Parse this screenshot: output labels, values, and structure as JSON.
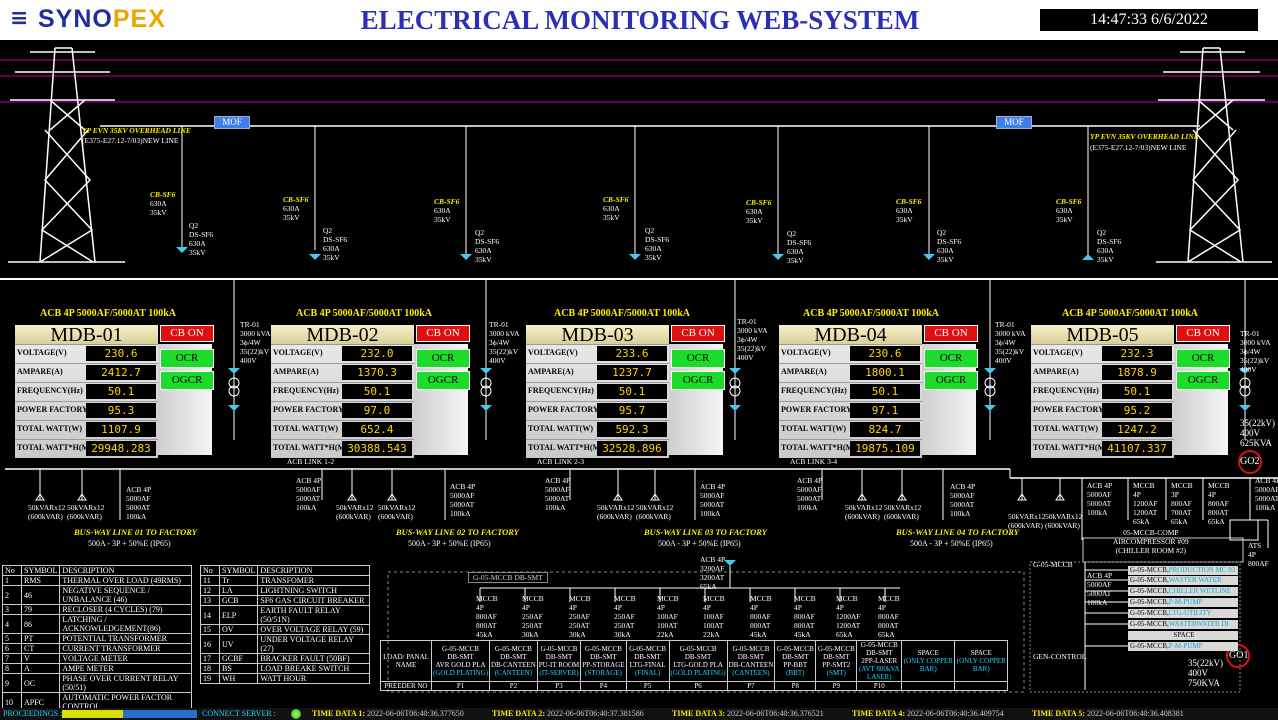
{
  "header": {
    "logo_part1": "SYNO",
    "logo_part2": "PEX",
    "title": "ELECTRICAL MONITORING WEB-SYSTEM",
    "clock": "14:47:33 6/6/2022"
  },
  "row_labels": [
    "VOLTAGE(V)",
    "AMPARE(A)",
    "FREQUENCY(Hz)",
    "POWER FACTORY(%)",
    "TOTAL WATT(W)",
    "TOTAL WATT*H(MWh)"
  ],
  "acb_title": "ACB 4P 5000AF/5000AT 100kA",
  "cb_on": "CB ON",
  "ocr": "OCR",
  "ogcr": "OGCR",
  "panels": [
    {
      "name": "MDB-01",
      "values": [
        "230.6",
        "2412.7",
        "50.1",
        "95.3",
        "1107.9",
        "29948.283"
      ]
    },
    {
      "name": "MDB-02",
      "values": [
        "232.0",
        "1370.3",
        "50.1",
        "97.0",
        "652.4",
        "30388.543"
      ]
    },
    {
      "name": "MDB-03",
      "values": [
        "233.6",
        "1237.7",
        "50.1",
        "95.7",
        "592.3",
        "32528.896"
      ]
    },
    {
      "name": "MDB-04",
      "values": [
        "230.6",
        "1800.1",
        "50.1",
        "97.1",
        "824.7",
        "19875.109"
      ]
    },
    {
      "name": "MDB-05",
      "values": [
        "232.3",
        "1878.9",
        "50.1",
        "95.2",
        "1247.2",
        "41107.337"
      ]
    }
  ],
  "overhead_line": "YP EVN 35KV OVERHEAD LINE",
  "overhead_code": "(E375-E27.12-7/03)NEW LINE",
  "mof": "MOF",
  "cb_sf6": "CB-SF6",
  "cb_sf6_spec": "630A\n35kV",
  "ds_sf6": "Q2\nDS-SF6\n630A\n35kV",
  "tr01": "TR-01\n3000 kVA\n3ϕ/4W\n35(22)kV\n400V",
  "acb_links": [
    "ACB LINK 1-2",
    "ACB LINK 2-3",
    "ACB LINK 3-4"
  ],
  "acb4p": "ACB 4P\n5000AF\n5000AT\n100kA",
  "capacitor": "50kVARx12\n(600kVAR)",
  "busway": [
    {
      "title": "BUS-WAY LINE 01 TO FACTORY",
      "sub": "500A - 3P + 50%E (IP65)"
    },
    {
      "title": "BUS-WAY LINE 02 TO FACTORY",
      "sub": "500A - 3P + 50%E (IP65)"
    },
    {
      "title": "BUS-WAY LINE 03 TO FACTORY",
      "sub": "500A - 3P + 50%E (IP65)"
    },
    {
      "title": "BUS-WAY LINE 04 TO FACTORY",
      "sub": "500A - 3P + 50%E (IP65)"
    }
  ],
  "transformer_out": "35(22kV)\n400V\n625KVA",
  "gen_out": "35(22kV)\n400V\n750KVA",
  "go2": "GO2",
  "go1": "GO1",
  "mccb_right": [
    "MCCB\n4P\n1200AF\n1200AT\n65kA",
    "MCCB\n3P\n800AF\n700AT\n65kA",
    "MCCB\n4P\n800AF\n800AT\n65kA",
    "MCCB\n4P\n800AF\n800AT\n65kA"
  ],
  "comp_label": "05-MCCB-COMP\nAIRCOMPRESSOR #09\n(CHILLER ROOM #2)",
  "ats": "ATS\n4P\n800AF",
  "g05_mccb": "G-05-MCCB",
  "gen_control": "GEN-CONTROL",
  "right_circuits": [
    {
      "prefix": "G-05-MCCB,",
      "name": "PRODUCTION MC 03"
    },
    {
      "prefix": "G-05-MCCB,",
      "name": "WASTER WATER"
    },
    {
      "prefix": "G-05-MCCB,",
      "name": "CHILLER WETLINE"
    },
    {
      "prefix": "G-05-MCCB,",
      "name": "P-M-PUMP"
    },
    {
      "prefix": "G-05-MCCB,",
      "name": "LTG-UTILITY"
    },
    {
      "prefix": "G-05-MCCB,",
      "name": "WASTERWATER DI"
    },
    {
      "prefix": "",
      "name": "SPACE"
    },
    {
      "prefix": "G-05-MCCB,",
      "name": "P-M-PUMP"
    }
  ],
  "db_smt": "G-05-MCCB DB-SMT",
  "acb_small": "ACB 4P\n3200AF\n3200AT\n65kA",
  "feeder_mccb": [
    "MCCB\n4P\n800AF\n800AT\n45kA",
    "MCCB\n4P\n250AF\n250AT\n30kA",
    "MCCB\n4P\n250AF\n250AT\n30kA",
    "MCCB\n4P\n250AF\n250AT\n30kA",
    "MCCB\n4P\n100AF\n100AT\n22kA",
    "MCCB\n4P\n100AF\n100AT\n22kA",
    "MCCB\n4P\n800AF\n800AT\n45kA",
    "MCCB\n4P\n800AF\n800AT\n45kA",
    "MCCB\n4P\n1200AF\n1200AT\n65kA",
    "MCCB\n4P\n800AF\n800AT\n65kA"
  ],
  "feeder_table": {
    "load_label": "LOAD/ PANAL NAME",
    "freeder_label": "FREEDER NO",
    "cols": [
      {
        "name": "G-05-MCCB\nDB-SMT\nAVR GOLD PLA",
        "tag": "(GOLD PLATING)",
        "no": "P1"
      },
      {
        "name": "G-05-MCCB\nDB-SMT\nDB-CANTEEN",
        "tag": "(CANTEEN)",
        "no": "P2"
      },
      {
        "name": "G-05-MCCB\nDB-SMT\nPU-IT ROOM",
        "tag": "(IT-SERVER)",
        "no": "P3"
      },
      {
        "name": "G-05-MCCB\nDB-SMT\nPP-STORAGE",
        "tag": "(STORAGE)",
        "no": "P4"
      },
      {
        "name": "G-05-MCCB\nDB-SMT\nLTG-FINAL",
        "tag": "(FINAL)",
        "no": "P5"
      },
      {
        "name": "G-05-MCCB\nDB-SMT\nLTG-GOLD PLA",
        "tag": "(GOLD PLATING)",
        "no": "P6"
      },
      {
        "name": "G-05-MCCB\nDB-SMT\nDB-CANTEEN",
        "tag": "(CANTEEN)",
        "no": "P7"
      },
      {
        "name": "G-05-MCCB\nDB-SMT\nPP-BBT",
        "tag": "(BBT)",
        "no": "P8"
      },
      {
        "name": "G-05-MCCB\nDB-SMT\nPP-SMT2",
        "tag": "(SMT)",
        "no": "P9"
      },
      {
        "name": "G-05-MCCB\nDB-SMT\n2PP-LASER",
        "tag": "(AVT 800kVA\nLASER)",
        "no": "P10"
      },
      {
        "name": "SPACE",
        "tag": "(ONLY COPPER\nBAR)",
        "no": ""
      },
      {
        "name": "SPACE",
        "tag": "(ONLY COPPER\nBAR)",
        "no": ""
      }
    ]
  },
  "legend_headers": [
    "No",
    "SYMBOL",
    "DESCRIPTION"
  ],
  "legend_left": [
    [
      "1",
      "RMS",
      "THERMAL OVER LOAD (49RMS)"
    ],
    [
      "2",
      "46",
      "NEGATIVE SEQUENCE / UNBALANCE (46)"
    ],
    [
      "3",
      "79",
      "RECLOSER (4 CYCLES) (79)"
    ],
    [
      "4",
      "86",
      "LATCHING / ACKNOWLEDGEMENT(86)"
    ],
    [
      "5",
      "PT",
      "POTENTIAL TRANSFORMER"
    ],
    [
      "6",
      "CT",
      "CURRENT TRANSFORMER"
    ],
    [
      "7",
      "V",
      "VOLTAGE METER"
    ],
    [
      "8",
      "A",
      "AMPE METER"
    ],
    [
      "9",
      "OC",
      "PHASE OVER CURRENT RELAY (50/51)"
    ],
    [
      "10",
      "APFC",
      "AUTOMATIC POWER FACTOR CONTROL"
    ]
  ],
  "legend_right": [
    [
      "11",
      "Tr",
      "TRANSFOMER"
    ],
    [
      "12",
      "LA",
      "LIGHTNING SWITCH"
    ],
    [
      "13",
      "GCB",
      "SF6 GAS CIRCUIT BREAKER"
    ],
    [
      "14",
      "ELP",
      "EARTH FAULT RELAY (50/51N)"
    ],
    [
      "15",
      "OV",
      "OVER VOLTAGE RELAY (59)"
    ],
    [
      "16",
      "UV",
      "UNDER VOLTAGE RELAY (27)"
    ],
    [
      "17",
      "GCBF",
      "BRACKER FAULT (50BF)"
    ],
    [
      "18",
      "BS",
      "LOAD BREAKE SWITCH"
    ],
    [
      "19",
      "WH",
      "WATT HOUR"
    ]
  ],
  "status": {
    "proceedings": "PROCEEDINGS :",
    "progress": 0.45,
    "connect": "CONNECT SERVER :",
    "times": [
      {
        "label": "TIME DATA 1:",
        "value": "2022-06-06T06:40:36.377650"
      },
      {
        "label": "TIME DATA 2:",
        "value": "2022-06-06T06:40:37.381586"
      },
      {
        "label": "TIME DATA 3:",
        "value": "2022-06-06T06:40:36.376521"
      },
      {
        "label": "TIME DATA 4:",
        "value": "2022-06-06T06:40:36.409754"
      },
      {
        "label": "TIME DATA 5:",
        "value": "2022-06-06T06:40:36.408381"
      }
    ]
  },
  "colors": {
    "header_blue": "#2b2fb6",
    "logo_orange": "#f0a400",
    "cb_on": "#e01010",
    "relay_green": "#1bdc2b",
    "meter_yellow": "#ffd400",
    "label_yellow": "#ffee00",
    "hv_line": "#b400b4"
  }
}
